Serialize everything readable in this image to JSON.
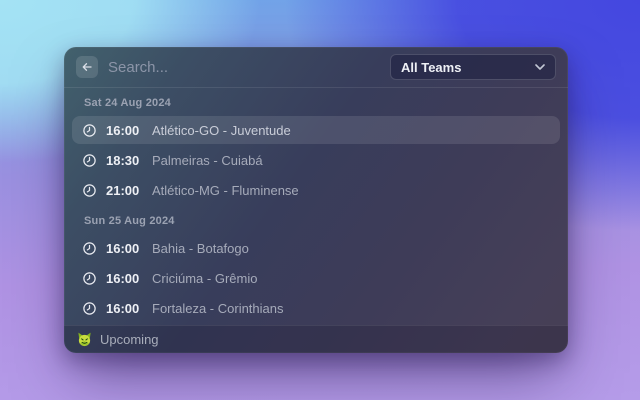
{
  "header": {
    "search_placeholder": "Search...",
    "search_value": "",
    "back_icon": "arrow-left-icon",
    "team_filter_label": "All Teams",
    "team_filter_icon": "chevron-down-icon"
  },
  "sections": [
    {
      "date": "Sat 24 Aug 2024",
      "matches": [
        {
          "time": "16:00",
          "fixture": "Atlético-GO - Juventude",
          "icon": "clock-icon",
          "selected": true
        },
        {
          "time": "18:30",
          "fixture": "Palmeiras - Cuiabá",
          "icon": "clock-icon",
          "selected": false
        },
        {
          "time": "21:00",
          "fixture": "Atlético-MG - Fluminense",
          "icon": "clock-icon",
          "selected": false
        }
      ]
    },
    {
      "date": "Sun 25 Aug 2024",
      "matches": [
        {
          "time": "16:00",
          "fixture": "Bahia - Botafogo",
          "icon": "clock-icon",
          "selected": false
        },
        {
          "time": "16:00",
          "fixture": "Criciúma - Grêmio",
          "icon": "clock-icon",
          "selected": false
        },
        {
          "time": "16:00",
          "fixture": "Fortaleza - Corinthians",
          "icon": "clock-icon",
          "selected": false
        }
      ]
    }
  ],
  "footer": {
    "status_label": "Upcoming",
    "league_icon": "brasileirao-league-icon"
  },
  "colors": {
    "backdrop_top_left": "#a4e3f4",
    "backdrop_top_right": "#4447e0",
    "backdrop_bottom": "#b59ce9",
    "window_tint_top_left": "#42616d",
    "window_tint_bottom_right": "#473f55",
    "selected_row_overlay": "#ffffff1b",
    "time_text": "#eef0f5",
    "fixture_text": "#a6abba",
    "league_green": "#c8dd3e",
    "league_green_dark": "#86b41e"
  }
}
